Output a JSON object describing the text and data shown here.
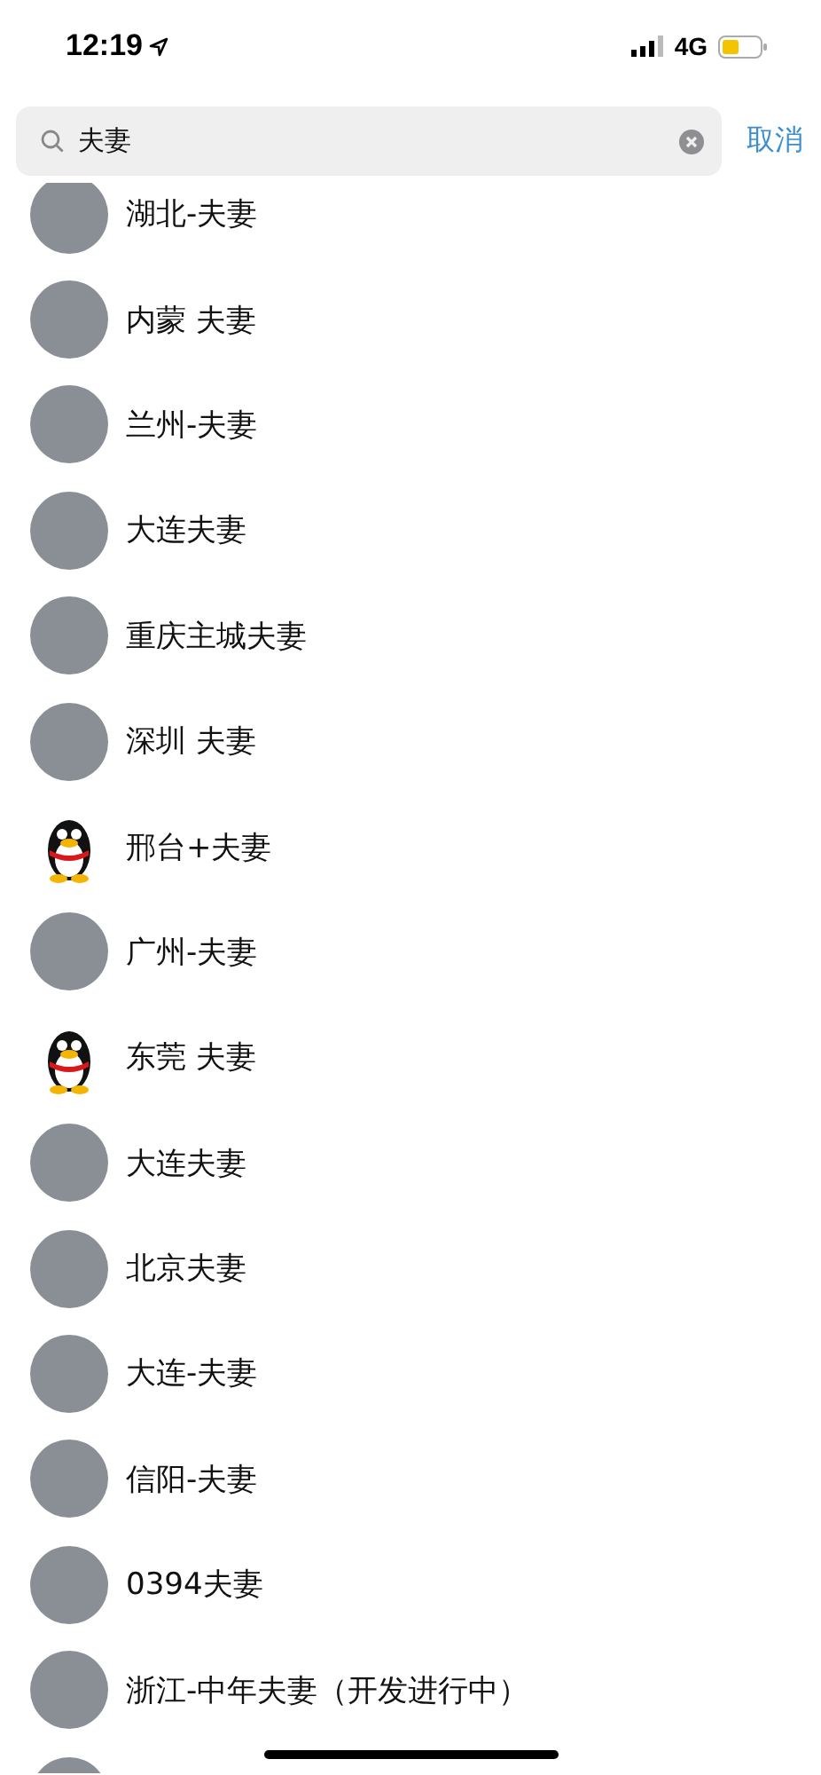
{
  "status_bar": {
    "time": "12:19",
    "network": "4G"
  },
  "search": {
    "value": "夫妻",
    "cancel": "取消"
  },
  "results": [
    {
      "kind": "photo",
      "name": "湖北-夫妻"
    },
    {
      "kind": "photo",
      "name": "内蒙 夫妻"
    },
    {
      "kind": "photo",
      "name": "兰州-夫妻"
    },
    {
      "kind": "photo",
      "name": "大连夫妻"
    },
    {
      "kind": "photo",
      "name": "重庆主城夫妻"
    },
    {
      "kind": "photo",
      "name": "深圳 夫妻"
    },
    {
      "kind": "penguin",
      "name": "邢台+夫妻"
    },
    {
      "kind": "photo",
      "name": "广州-夫妻"
    },
    {
      "kind": "penguin",
      "name": "东莞 夫妻"
    },
    {
      "kind": "photo",
      "name": "大连夫妻"
    },
    {
      "kind": "photo",
      "name": "北京夫妻"
    },
    {
      "kind": "photo",
      "name": "大连-夫妻"
    },
    {
      "kind": "photo",
      "name": "信阳-夫妻"
    },
    {
      "kind": "photo",
      "name": "0394夫妻"
    },
    {
      "kind": "photo",
      "name": "浙江-中年夫妻（开发进行中）"
    },
    {
      "kind": "photo"
    }
  ]
}
